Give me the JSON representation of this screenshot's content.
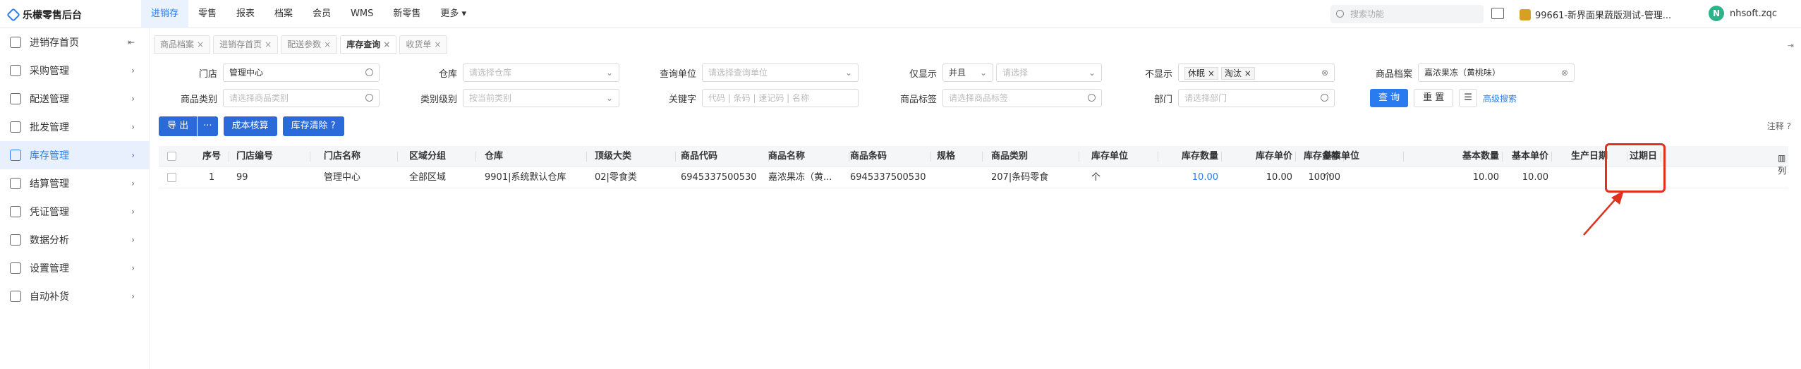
{
  "app": {
    "logo": "乐檬零售后台"
  },
  "nav": [
    "进销存",
    "零售",
    "报表",
    "档案",
    "会员",
    "WMS",
    "新零售",
    "更多 ▾"
  ],
  "top": {
    "search_placeholder": "搜索功能",
    "store": "99661-新界面果蔬版测试-管理...",
    "avatar_letter": "N",
    "user": "nhsoft.zqc"
  },
  "sidebar": {
    "items": [
      {
        "label": "进销存首页",
        "arrow": "⇤"
      },
      {
        "label": "采购管理",
        "arrow": "›"
      },
      {
        "label": "配送管理",
        "arrow": "›"
      },
      {
        "label": "批发管理",
        "arrow": "›"
      },
      {
        "label": "库存管理",
        "arrow": "›"
      },
      {
        "label": "结算管理",
        "arrow": "›"
      },
      {
        "label": "凭证管理",
        "arrow": "›"
      },
      {
        "label": "数据分析",
        "arrow": "›"
      },
      {
        "label": "设置管理",
        "arrow": "›"
      },
      {
        "label": "自动补货",
        "arrow": "›"
      }
    ]
  },
  "tabs": [
    {
      "label": "商品档案"
    },
    {
      "label": "进销存首页"
    },
    {
      "label": "配送参数"
    },
    {
      "label": "库存查询"
    },
    {
      "label": "收货单"
    }
  ],
  "filters": {
    "store_label": "门店",
    "store_value": "管理中心",
    "warehouse_label": "仓库",
    "warehouse_ph": "请选择仓库",
    "query_unit_label": "查询单位",
    "query_unit_ph": "请选择查询单位",
    "only_show_label": "仅显示",
    "only_show_op": "并且",
    "only_show_ph": "请选择",
    "hide_label": "不显示",
    "hide_tags": [
      "休眠",
      "淘汰"
    ],
    "goods_file_label": "商品档案",
    "goods_file_value": "嘉浓果冻（黄桃味）",
    "category_label": "商品类别",
    "category_ph": "请选择商品类别",
    "cat_level_label": "类别级别",
    "cat_level_ph": "按当前类别",
    "keyword_label": "关键字",
    "keyword_ph": "代码 | 条码 | 速记码 | 名称",
    "tag_label": "商品标签",
    "tag_ph": "请选择商品标签",
    "dept_label": "部门",
    "dept_ph": "请选择部门",
    "query_btn": "查 询",
    "reset_btn": "重 置",
    "adv_search": "高级搜索"
  },
  "actions": {
    "export": "导 出",
    "more": "···",
    "cost": "成本核算",
    "clear": "库存清除"
  },
  "note": "注释",
  "table": {
    "headers": [
      "序号",
      "门店编号",
      "门店名称",
      "区域分组",
      "仓库",
      "顶级大类",
      "商品代码",
      "商品名称",
      "商品条码",
      "规格",
      "商品类别",
      "库存单位",
      "库存数量",
      "库存单价",
      "库存金额",
      "基本单位",
      "基本数量",
      "基本单价",
      "生产日期",
      "过期日"
    ],
    "rows": [
      [
        "1",
        "99",
        "管理中心",
        "全部区域",
        "9901|系统默认仓库",
        "02|零食类",
        "6945337500530",
        "嘉浓果冻（黄...",
        "6945337500530",
        "",
        "207|条码零食",
        "个",
        "10.00",
        "10.00",
        "100.00",
        "个",
        "10.00",
        "10.00",
        "",
        ""
      ]
    ],
    "side_label": "列"
  },
  "colors": {
    "accent": "#2a7bef",
    "highlight": "#e0301e"
  }
}
